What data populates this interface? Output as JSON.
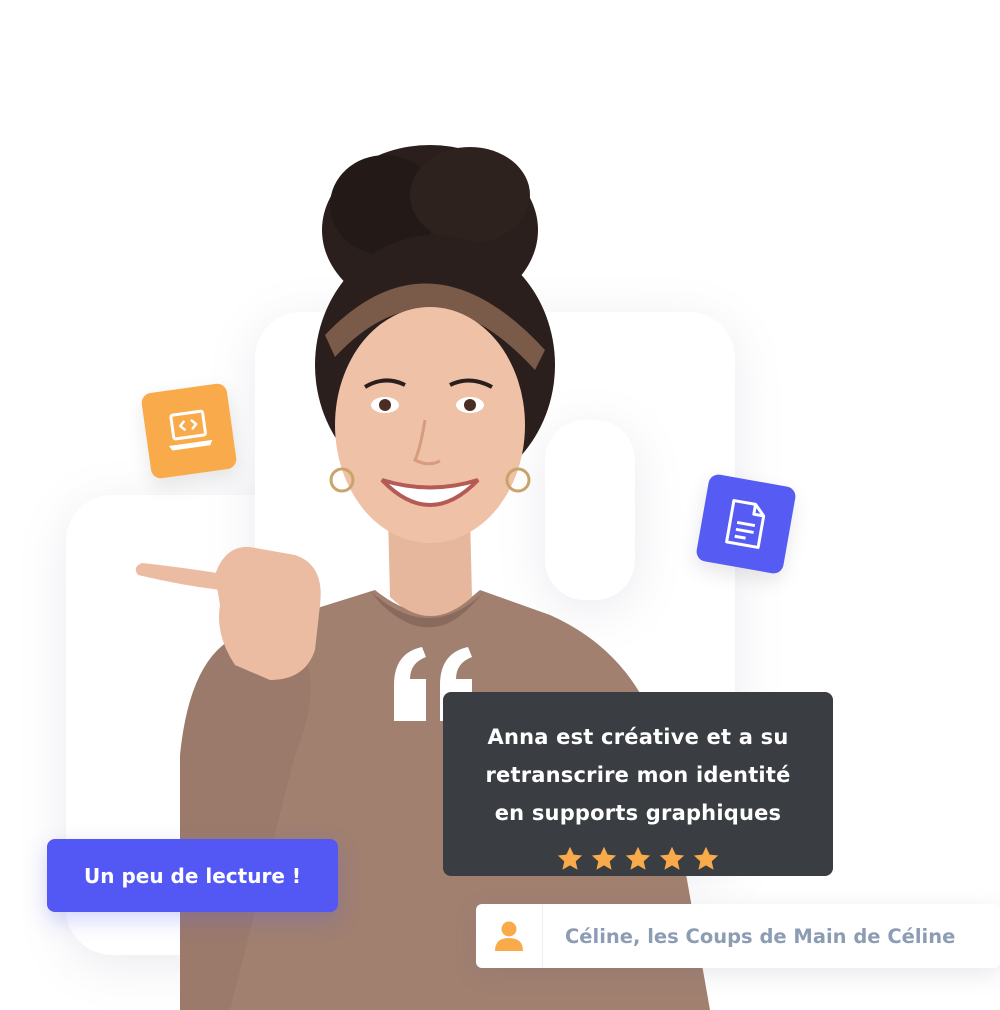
{
  "colors": {
    "accent_blue": "#5357f3",
    "accent_orange": "#f9aa4b",
    "card_dark": "#3a3d42",
    "star": "#f9aa4b",
    "author_text": "#8c9cb3"
  },
  "icons": {
    "tile_left": "laptop-code-icon",
    "tile_right": "document-icon",
    "author": "user-icon",
    "quote": "quote-icon"
  },
  "testimonial": {
    "line1": "Anna est créative et a su",
    "line2": "retranscrire mon identité",
    "line3": "en supports graphiques",
    "rating": 5
  },
  "author": {
    "name": "Céline, les Coups de Main de Céline"
  },
  "cta": {
    "label": "Un peu de lecture !"
  }
}
